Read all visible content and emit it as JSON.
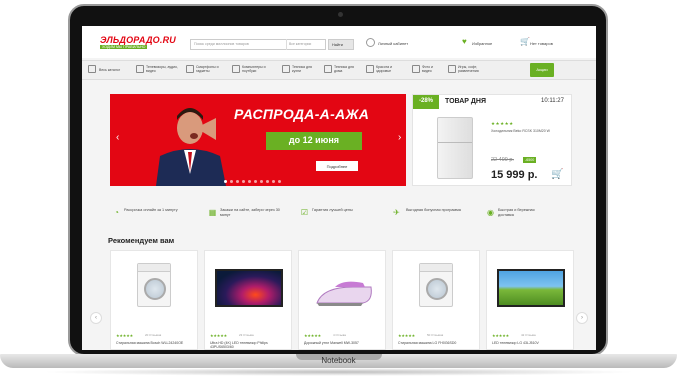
{
  "header": {
    "logo": "ЭЛЬДОРАДО.RU",
    "logo_sub": "ХОДИМ МЫ ПРАВИЛЬНО",
    "search_placeholder": "Поиск среди миллионов товаров",
    "search_category": "Все категории",
    "search_button": "Найти",
    "account": "Личный кабинет",
    "favorites": "Избранное",
    "cart": "Нет товаров"
  },
  "nav": {
    "catalog": "Весь каталог",
    "items": [
      "Телевизоры, аудио, видео",
      "Смартфоны и гаджеты",
      "Компьютеры и ноутбуки",
      "Техника для кухни",
      "Техника для дома",
      "Красота и здоровье",
      "Фото и видео",
      "Игры, софт, развлечения"
    ],
    "sale": "Акции"
  },
  "banner": {
    "title": "РАСПРОДА-А-АЖА",
    "date": "до 12 июня",
    "button": "Подробнее",
    "dots_count": 10,
    "active_dot": 0
  },
  "deal": {
    "discount": "-28%",
    "title": "ТОВАР ДНЯ",
    "timer": "10:11:27",
    "stars": "★★★★★",
    "name": "Холодильник Beko RCSK 310M20 W",
    "old_price": "22 499 р.",
    "save": "-6500",
    "price": "15 999 р."
  },
  "features": [
    "Рассрочка онлайн за 1 минуту",
    "Закажи на сайте, забери через 30 минут",
    "Гарантия лучшей цены",
    "Выгодная бонусная программа",
    "Быстрая и бережная доставка"
  ],
  "recommend": {
    "title": "Рекомендуем вам",
    "products": [
      {
        "name": "Стиральная машина Bosch WLL24240OE",
        "reviews": "20 Отзывов",
        "stars": "★★★★★"
      },
      {
        "name": "Ultra HD (4K) LED телевизор Philips 43PUS6503/60",
        "reviews": "23 Отзыва",
        "stars": "★★★★★"
      },
      {
        "name": "Дорожный утюг Maxwell MW-3057",
        "reviews": "4 Отзыва",
        "stars": "★★★★★"
      },
      {
        "name": "Стиральная машина LG FH0G6SD0",
        "reviews": "50 Отзывов",
        "stars": "★★★★★"
      },
      {
        "name": "LED телевизор LG 43LJ510V",
        "reviews": "42 Отзыва",
        "stars": "★★★★★"
      }
    ]
  },
  "device_label": "Notebook",
  "colors": {
    "brand_red": "#e30613",
    "brand_green": "#6ab023"
  }
}
